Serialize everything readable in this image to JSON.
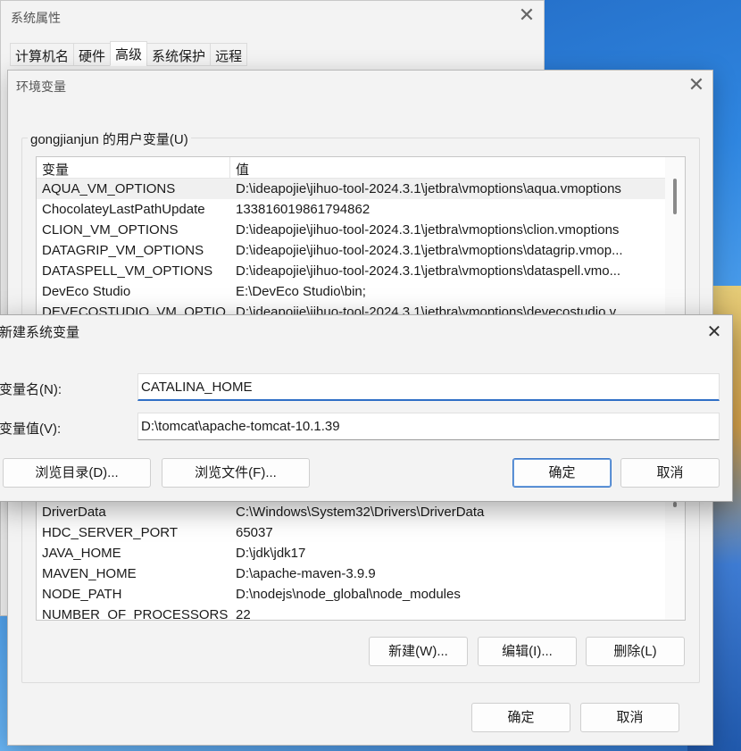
{
  "sys_window": {
    "title": "系统属性",
    "tabs": [
      {
        "label": "计算机名"
      },
      {
        "label": "硬件"
      },
      {
        "label": "高级"
      },
      {
        "label": "系统保护"
      },
      {
        "label": "远程"
      }
    ]
  },
  "env_window": {
    "title": "环境变量",
    "user_group_label": "gongjianjun 的用户变量(U)",
    "col_name": "变量",
    "col_value": "值",
    "user_vars": [
      {
        "name": "AQUA_VM_OPTIONS",
        "value": "D:\\ideapojie\\jihuo-tool-2024.3.1\\jetbra\\vmoptions\\aqua.vmoptions"
      },
      {
        "name": "ChocolateyLastPathUpdate",
        "value": "133816019861794862"
      },
      {
        "name": "CLION_VM_OPTIONS",
        "value": "D:\\ideapojie\\jihuo-tool-2024.3.1\\jetbra\\vmoptions\\clion.vmoptions"
      },
      {
        "name": "DATAGRIP_VM_OPTIONS",
        "value": "D:\\ideapojie\\jihuo-tool-2024.3.1\\jetbra\\vmoptions\\datagrip.vmop..."
      },
      {
        "name": "DATASPELL_VM_OPTIONS",
        "value": "D:\\ideapojie\\jihuo-tool-2024.3.1\\jetbra\\vmoptions\\dataspell.vmo..."
      },
      {
        "name": "DevEco Studio",
        "value": "E:\\DevEco Studio\\bin;"
      },
      {
        "name": "DEVECOSTUDIO_VM_OPTIO...",
        "value": "D:\\ideapojie\\jihuo-tool-2024.3.1\\jetbra\\vmoptions\\devecostudio.v..."
      }
    ],
    "sys_vars": [
      {
        "name": "DriverData",
        "value": "C:\\Windows\\System32\\Drivers\\DriverData"
      },
      {
        "name": "HDC_SERVER_PORT",
        "value": "65037"
      },
      {
        "name": "JAVA_HOME",
        "value": "D:\\jdk\\jdk17"
      },
      {
        "name": "MAVEN_HOME",
        "value": "D:\\apache-maven-3.9.9"
      },
      {
        "name": "NODE_PATH",
        "value": "D:\\nodejs\\node_global\\node_modules"
      },
      {
        "name": "NUMBER_OF_PROCESSORS",
        "value": "22"
      }
    ],
    "btn_new": "新建(W)...",
    "btn_edit": "编辑(I)...",
    "btn_delete": "删除(L)",
    "btn_ok": "确定",
    "btn_cancel": "取消"
  },
  "new_dialog": {
    "title": "新建系统变量",
    "name_label": "变量名(N):",
    "name_value": "CATALINA_HOME",
    "value_label": "变量值(V):",
    "value_value": "D:\\tomcat\\apache-tomcat-10.1.39",
    "btn_browse_dir": "浏览目录(D)...",
    "btn_browse_file": "浏览文件(F)...",
    "btn_ok": "确定",
    "btn_cancel": "取消"
  }
}
